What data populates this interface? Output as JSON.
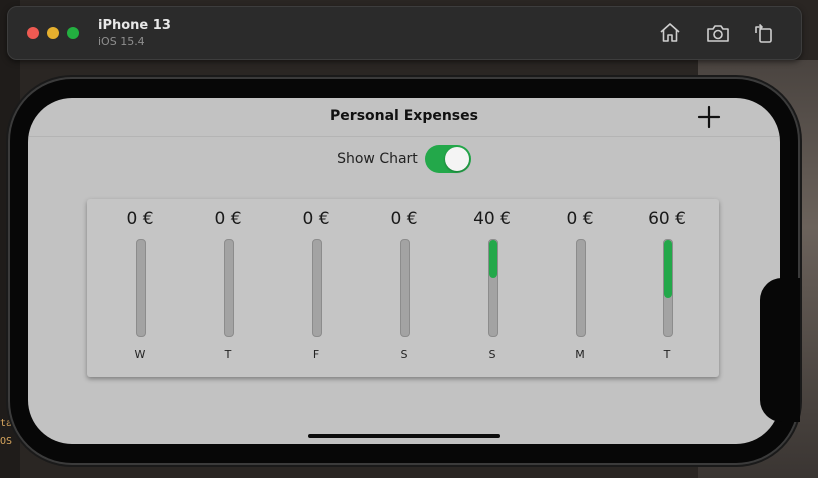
{
  "simulator": {
    "device_name": "iPhone 13",
    "os_version": "iOS 15.4",
    "icons": [
      "home-icon",
      "camera-icon",
      "rotate-icon"
    ]
  },
  "app": {
    "title": "Personal Expenses",
    "add_icon": "plus-icon",
    "show_chart_label": "Show Chart",
    "show_chart_enabled": true,
    "accent_color": "#23a84a"
  },
  "chart_data": {
    "type": "bar",
    "categories": [
      "W",
      "T",
      "F",
      "S",
      "S",
      "M",
      "T"
    ],
    "labels": [
      "0 €",
      "0 €",
      "0 €",
      "0 €",
      "40 €",
      "0 €",
      "60 €"
    ],
    "values": [
      0,
      0,
      0,
      0,
      40,
      0,
      60
    ],
    "fill_fractions": [
      0,
      0,
      0,
      0,
      0.4,
      0,
      0.6
    ]
  },
  "background_code": [
    "ta",
    "OS"
  ]
}
